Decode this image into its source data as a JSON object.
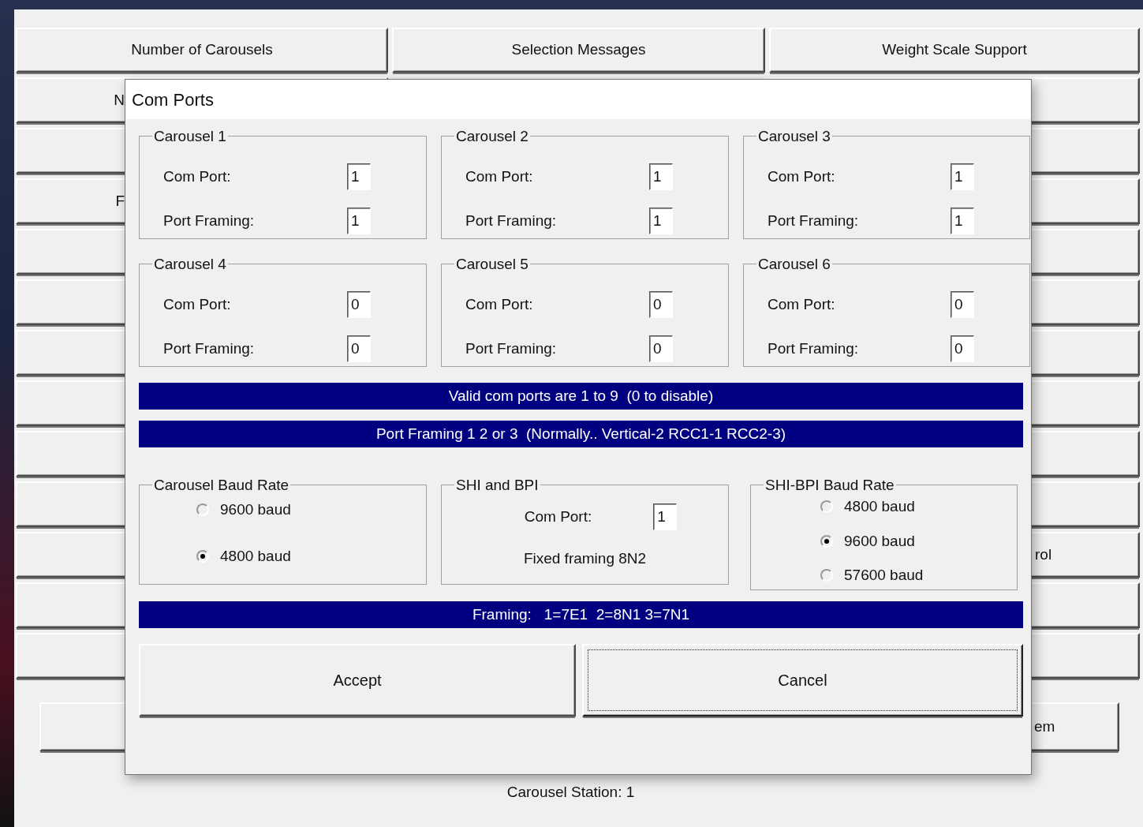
{
  "app": {
    "top_buttons": [
      "Number of Carousels",
      "Selection Messages",
      "Weight Scale Support"
    ],
    "side_rows": [
      {
        "kind": "labeled",
        "left": "N"
      },
      {
        "kind": "plain"
      },
      {
        "kind": "labeled",
        "left": "F"
      },
      {
        "kind": "plain"
      },
      {
        "kind": "plain"
      },
      {
        "kind": "plain"
      },
      {
        "kind": "plain"
      },
      {
        "kind": "plain"
      },
      {
        "kind": "plain"
      },
      {
        "kind": "labeled",
        "right": "rol"
      },
      {
        "kind": "plain"
      },
      {
        "kind": "plain"
      }
    ],
    "bottom_buttons": [
      {
        "kind": "plain"
      },
      {
        "kind": "labeled",
        "right": "em"
      }
    ],
    "status": "Carousel Station: 1"
  },
  "dialog": {
    "title": "Com Ports",
    "carousels": [
      {
        "title": "Carousel 1",
        "fields": [
          {
            "label": "Com Port:",
            "value": "1"
          },
          {
            "label": "Port Framing:",
            "value": "1"
          }
        ]
      },
      {
        "title": "Carousel 2",
        "fields": [
          {
            "label": "Com Port:",
            "value": "1"
          },
          {
            "label": "Port Framing:",
            "value": "1"
          }
        ]
      },
      {
        "title": "Carousel 3",
        "fields": [
          {
            "label": "Com Port:",
            "value": "1"
          },
          {
            "label": "Port Framing:",
            "value": "1"
          }
        ]
      },
      {
        "title": "Carousel 4",
        "fields": [
          {
            "label": "Com Port:",
            "value": "0"
          },
          {
            "label": "Port Framing:",
            "value": "0"
          }
        ]
      },
      {
        "title": "Carousel 5",
        "fields": [
          {
            "label": "Com Port:",
            "value": "0"
          },
          {
            "label": "Port Framing:",
            "value": "0"
          }
        ]
      },
      {
        "title": "Carousel 6",
        "fields": [
          {
            "label": "Com Port:",
            "value": "0"
          },
          {
            "label": "Port Framing:",
            "value": "0"
          }
        ]
      }
    ],
    "banners": [
      "Valid com ports are 1 to 9  (0 to disable)",
      "Port Framing 1 2 or 3  (Normally.. Vertical-2 RCC1-1 RCC2-3)"
    ],
    "carousel_baud": {
      "title": "Carousel Baud Rate",
      "options": [
        {
          "label": "9600 baud",
          "selected": false
        },
        {
          "label": "4800 baud",
          "selected": true
        }
      ]
    },
    "shi_bpi": {
      "title": "SHI and BPI",
      "com_port_label": "Com Port:",
      "com_port_value": "1",
      "note": "Fixed framing 8N2"
    },
    "shi_bpi_baud": {
      "title": "SHI-BPI Baud Rate",
      "options": [
        {
          "label": "4800 baud",
          "selected": false
        },
        {
          "label": "9600 baud",
          "selected": true
        },
        {
          "label": "57600 baud",
          "selected": false
        }
      ]
    },
    "framing_banner": "Framing:   1=7E1  2=8N1 3=7N1",
    "buttons": [
      {
        "label": "Accept",
        "focused": false
      },
      {
        "label": "Cancel",
        "focused": true
      }
    ]
  }
}
